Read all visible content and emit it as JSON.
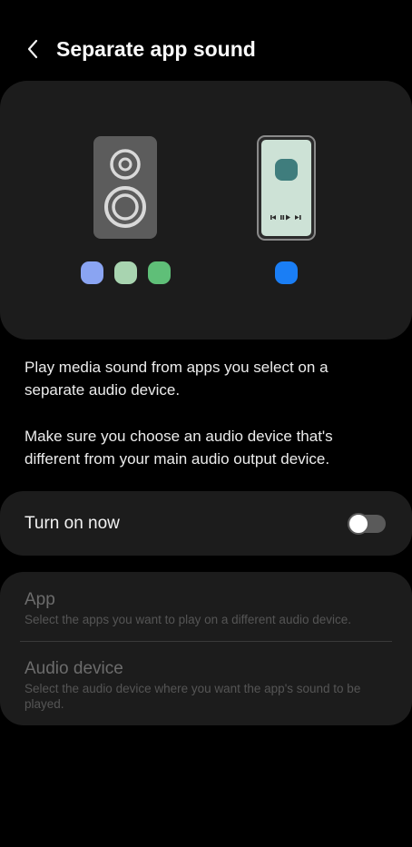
{
  "header": {
    "title": "Separate app sound",
    "back_icon": "back-arrow-icon"
  },
  "illustration": {
    "speaker_icon": "speaker-icon",
    "phone_icon": "phone-icon",
    "app_dot_colors": [
      "#8aa4f2",
      "#a8d4b0",
      "#5fbf78"
    ],
    "phone_dot_color": "#1a7ef5",
    "phone_screen_color": "#cde2d6",
    "phone_app_color": "#3f7d7d"
  },
  "description": {
    "line1": "Play media sound from apps you select on a separate audio device.",
    "line2": "Make sure you choose an audio device that's different from your main audio output device."
  },
  "toggle": {
    "label": "Turn on now",
    "state": "off"
  },
  "settings": [
    {
      "title": "App",
      "subtitle": "Select the apps you want to play on a different audio device."
    },
    {
      "title": "Audio device",
      "subtitle": "Select the audio device where you want the app's sound to be played."
    }
  ]
}
